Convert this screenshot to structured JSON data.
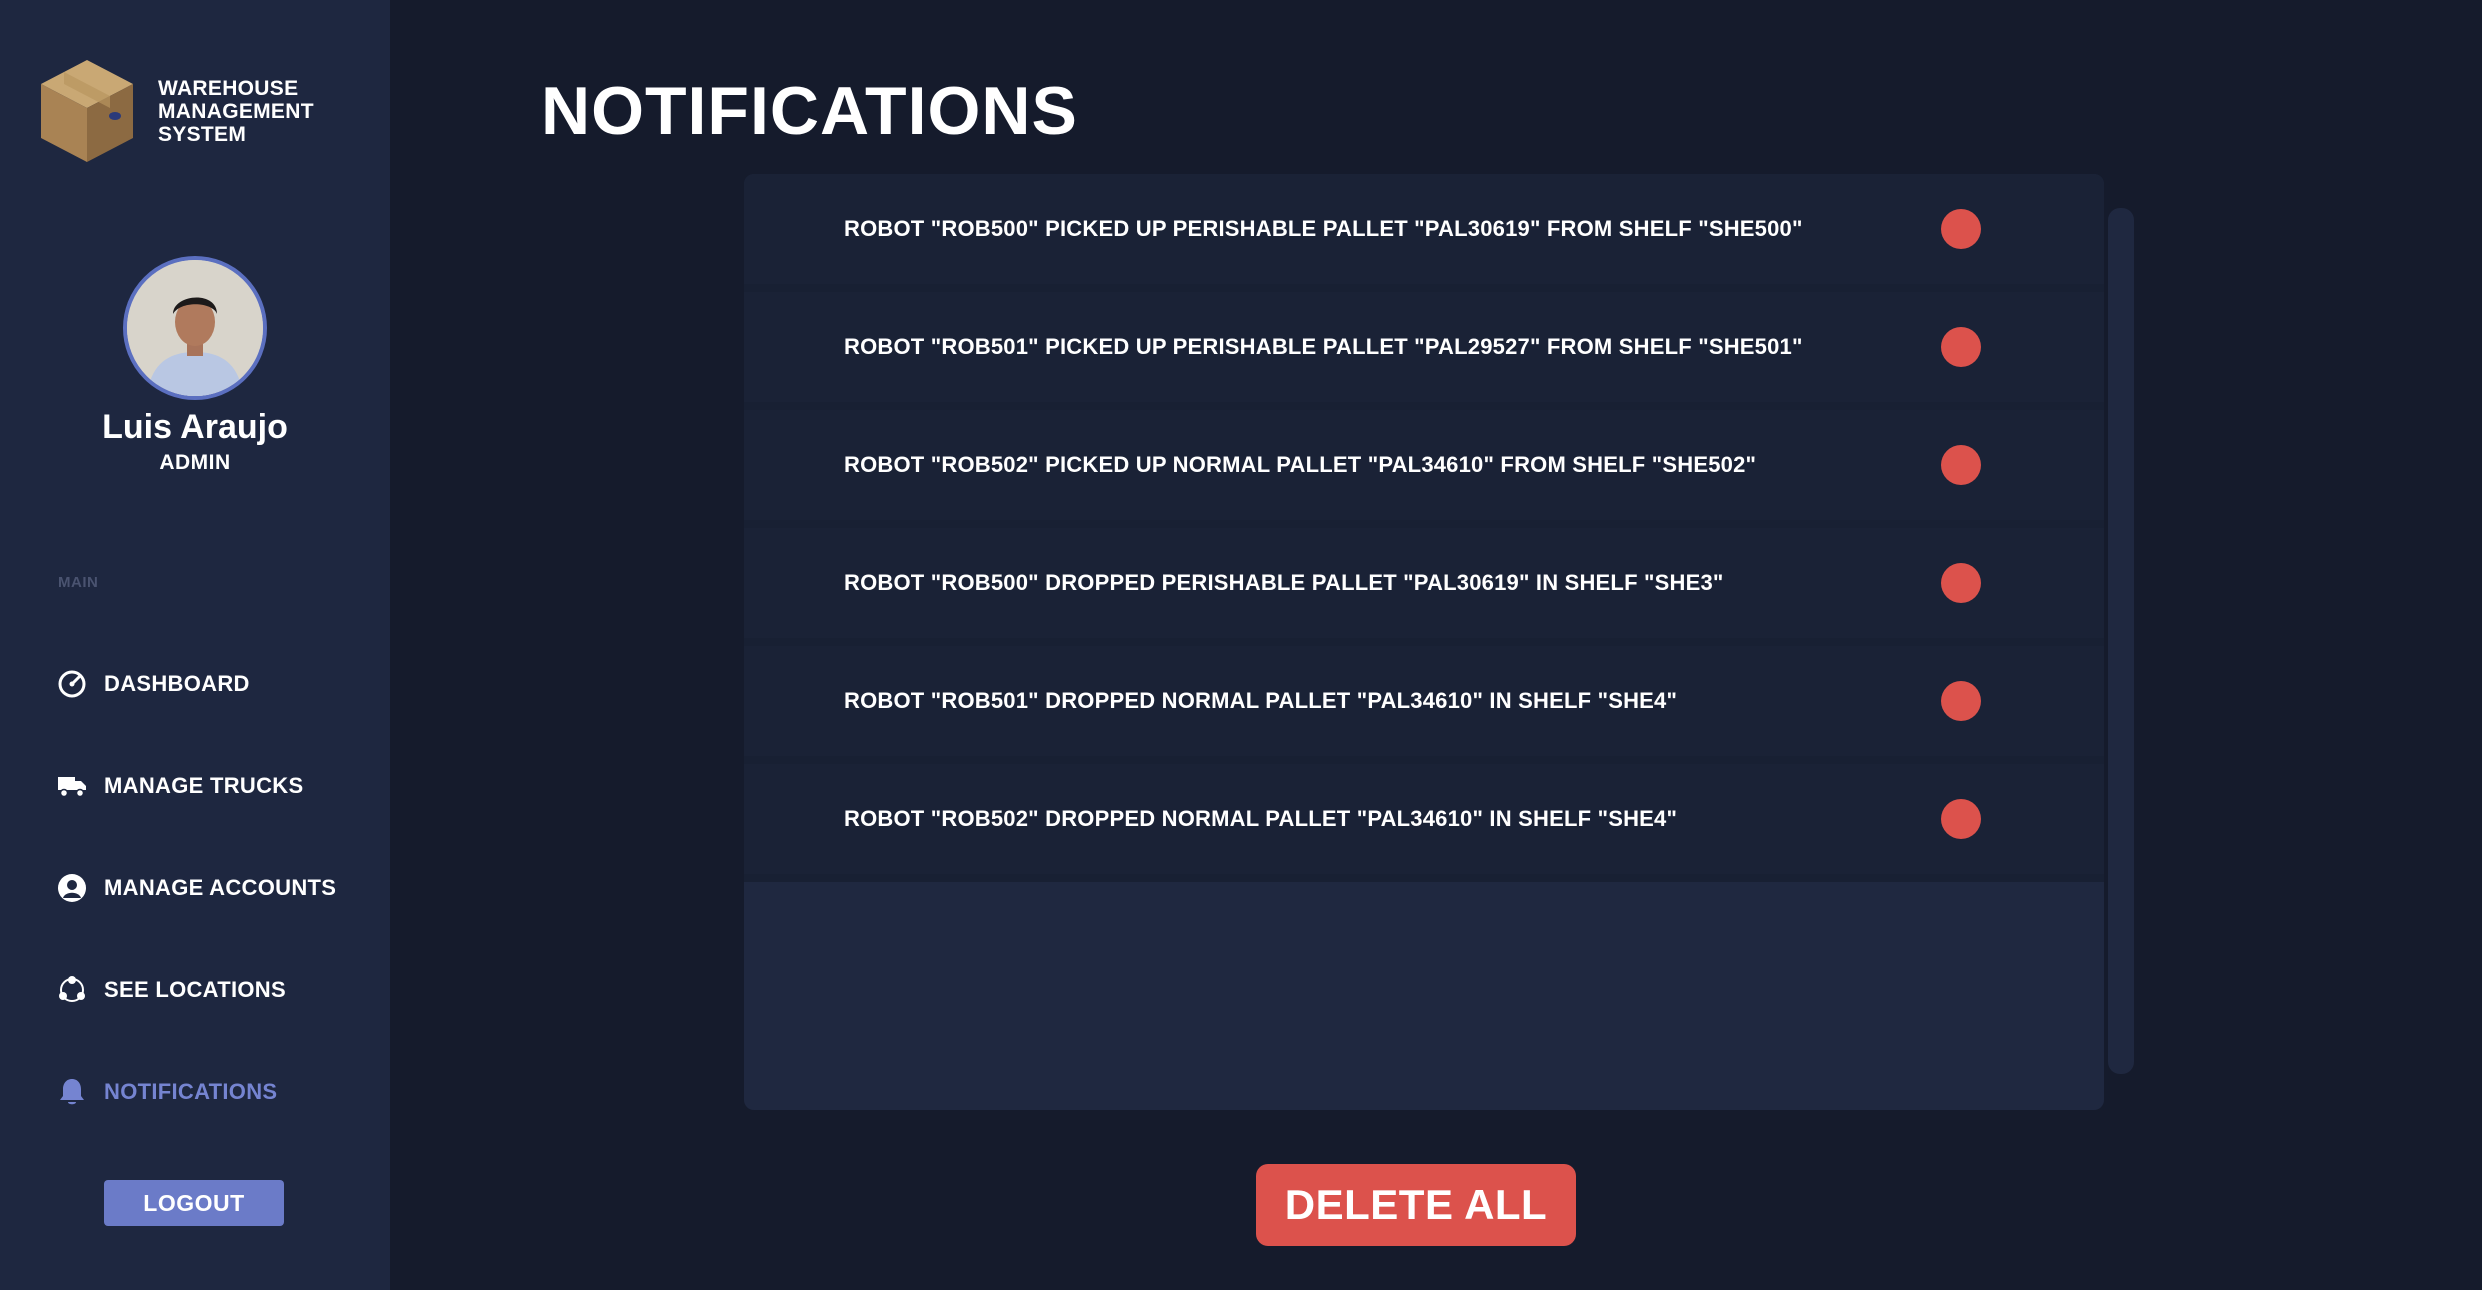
{
  "brand": {
    "line1": "WAREHOUSE",
    "line2": "MANAGEMENT",
    "line3": "SYSTEM",
    "logo_icon": "cardboard-box-icon"
  },
  "profile": {
    "name": "Luis Araujo",
    "role": "ADMIN"
  },
  "nav": {
    "section_label": "MAIN",
    "items": [
      {
        "label": "DASHBOARD",
        "icon": "speedometer-icon"
      },
      {
        "label": "MANAGE TRUCKS",
        "icon": "truck-icon"
      },
      {
        "label": "MANAGE ACCOUNTS",
        "icon": "user-circle-icon"
      },
      {
        "label": "SEE LOCATIONS",
        "icon": "location-network-icon"
      },
      {
        "label": "NOTIFICATIONS",
        "icon": "bell-icon",
        "active": true
      }
    ],
    "logout_label": "LOGOUT"
  },
  "main": {
    "title": "NOTIFICATIONS",
    "notifications": [
      "ROBOT \"ROB500\" PICKED UP PERISHABLE PALLET \"PAL30619\" FROM SHELF \"SHE500\"",
      "ROBOT \"ROB501\" PICKED UP PERISHABLE PALLET \"PAL29527\" FROM SHELF \"SHE501\"",
      "ROBOT \"ROB502\" PICKED UP NORMAL PALLET \"PAL34610\" FROM SHELF \"SHE502\"",
      "ROBOT \"ROB500\" DROPPED PERISHABLE PALLET \"PAL30619\" IN SHELF \"SHE3\"",
      "ROBOT \"ROB501\" DROPPED NORMAL PALLET \"PAL34610\" IN SHELF \"SHE4\"",
      "ROBOT \"ROB502\" DROPPED NORMAL PALLET \"PAL34610\" IN SHELF \"SHE4\""
    ],
    "delete_all_label": "DELETE ALL"
  },
  "colors": {
    "background": "#151b2c",
    "sidebar": "#1e2740",
    "accent": "#6b7bc8",
    "danger": "#dc524c"
  }
}
